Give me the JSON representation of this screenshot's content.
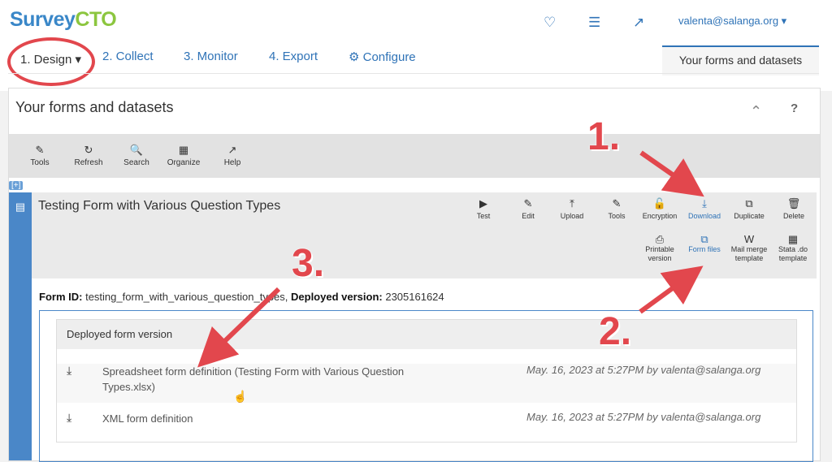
{
  "app": {
    "logo": [
      "Surv",
      "ey",
      "CTO"
    ],
    "user": "valenta@salanga.org ▾"
  },
  "nav": {
    "design": "1. Design ▾",
    "collect": "2. Collect",
    "monitor": "3. Monitor",
    "export": "4. Export",
    "configure": "⚙ Configure",
    "right_tab": "Your forms and datasets"
  },
  "panel": {
    "title": "Your forms and datasets",
    "help": "?",
    "toolbar": [
      {
        "label": "Tools",
        "icon": "✎"
      },
      {
        "label": "Refresh",
        "icon": "↻"
      },
      {
        "label": "Search",
        "icon": "🔍"
      },
      {
        "label": "Organize",
        "icon": "▦"
      },
      {
        "label": "Help",
        "icon": "↗"
      }
    ]
  },
  "form": {
    "title": "Testing Form with Various Question Types",
    "actions": [
      {
        "label": "Test",
        "icon": "▶"
      },
      {
        "label": "Edit",
        "icon": "✎"
      },
      {
        "label": "Upload",
        "icon": "⤒"
      },
      {
        "label": "Tools",
        "icon": "✎"
      },
      {
        "label": "Encryption",
        "icon": "🔓"
      },
      {
        "label": "Download",
        "icon": "⤓"
      },
      {
        "label": "Duplicate",
        "icon": "⧉"
      },
      {
        "label": "Delete",
        "icon": "🗑"
      }
    ],
    "subactions": [
      {
        "label": "Printable version",
        "icon": "⎙"
      },
      {
        "label": "Form files",
        "icon": "⧉"
      },
      {
        "label": "Mail merge template",
        "icon": "W"
      },
      {
        "label": "Stata .do template",
        "icon": "▦"
      }
    ],
    "form_id_label": "Form ID:",
    "form_id": "testing_form_with_various_question_types",
    "deployed_label": "Deployed version:",
    "deployed_version": "2305161624",
    "deployed_heading": "Deployed form version",
    "files": [
      {
        "name": "Spreadsheet form definition (Testing Form with Various Question Types.xlsx)",
        "meta": "May. 16, 2023 at 5:27PM by valenta@salanga.org"
      },
      {
        "name": "XML form definition",
        "meta": "May. 16, 2023 at 5:27PM by valenta@salanga.org"
      }
    ]
  },
  "annotations": {
    "one": "1.",
    "two": "2.",
    "three": "3."
  },
  "colors": {
    "accent": "#2f73b7",
    "brand_green": "#8cc63f",
    "annotation": "#e2474d"
  }
}
